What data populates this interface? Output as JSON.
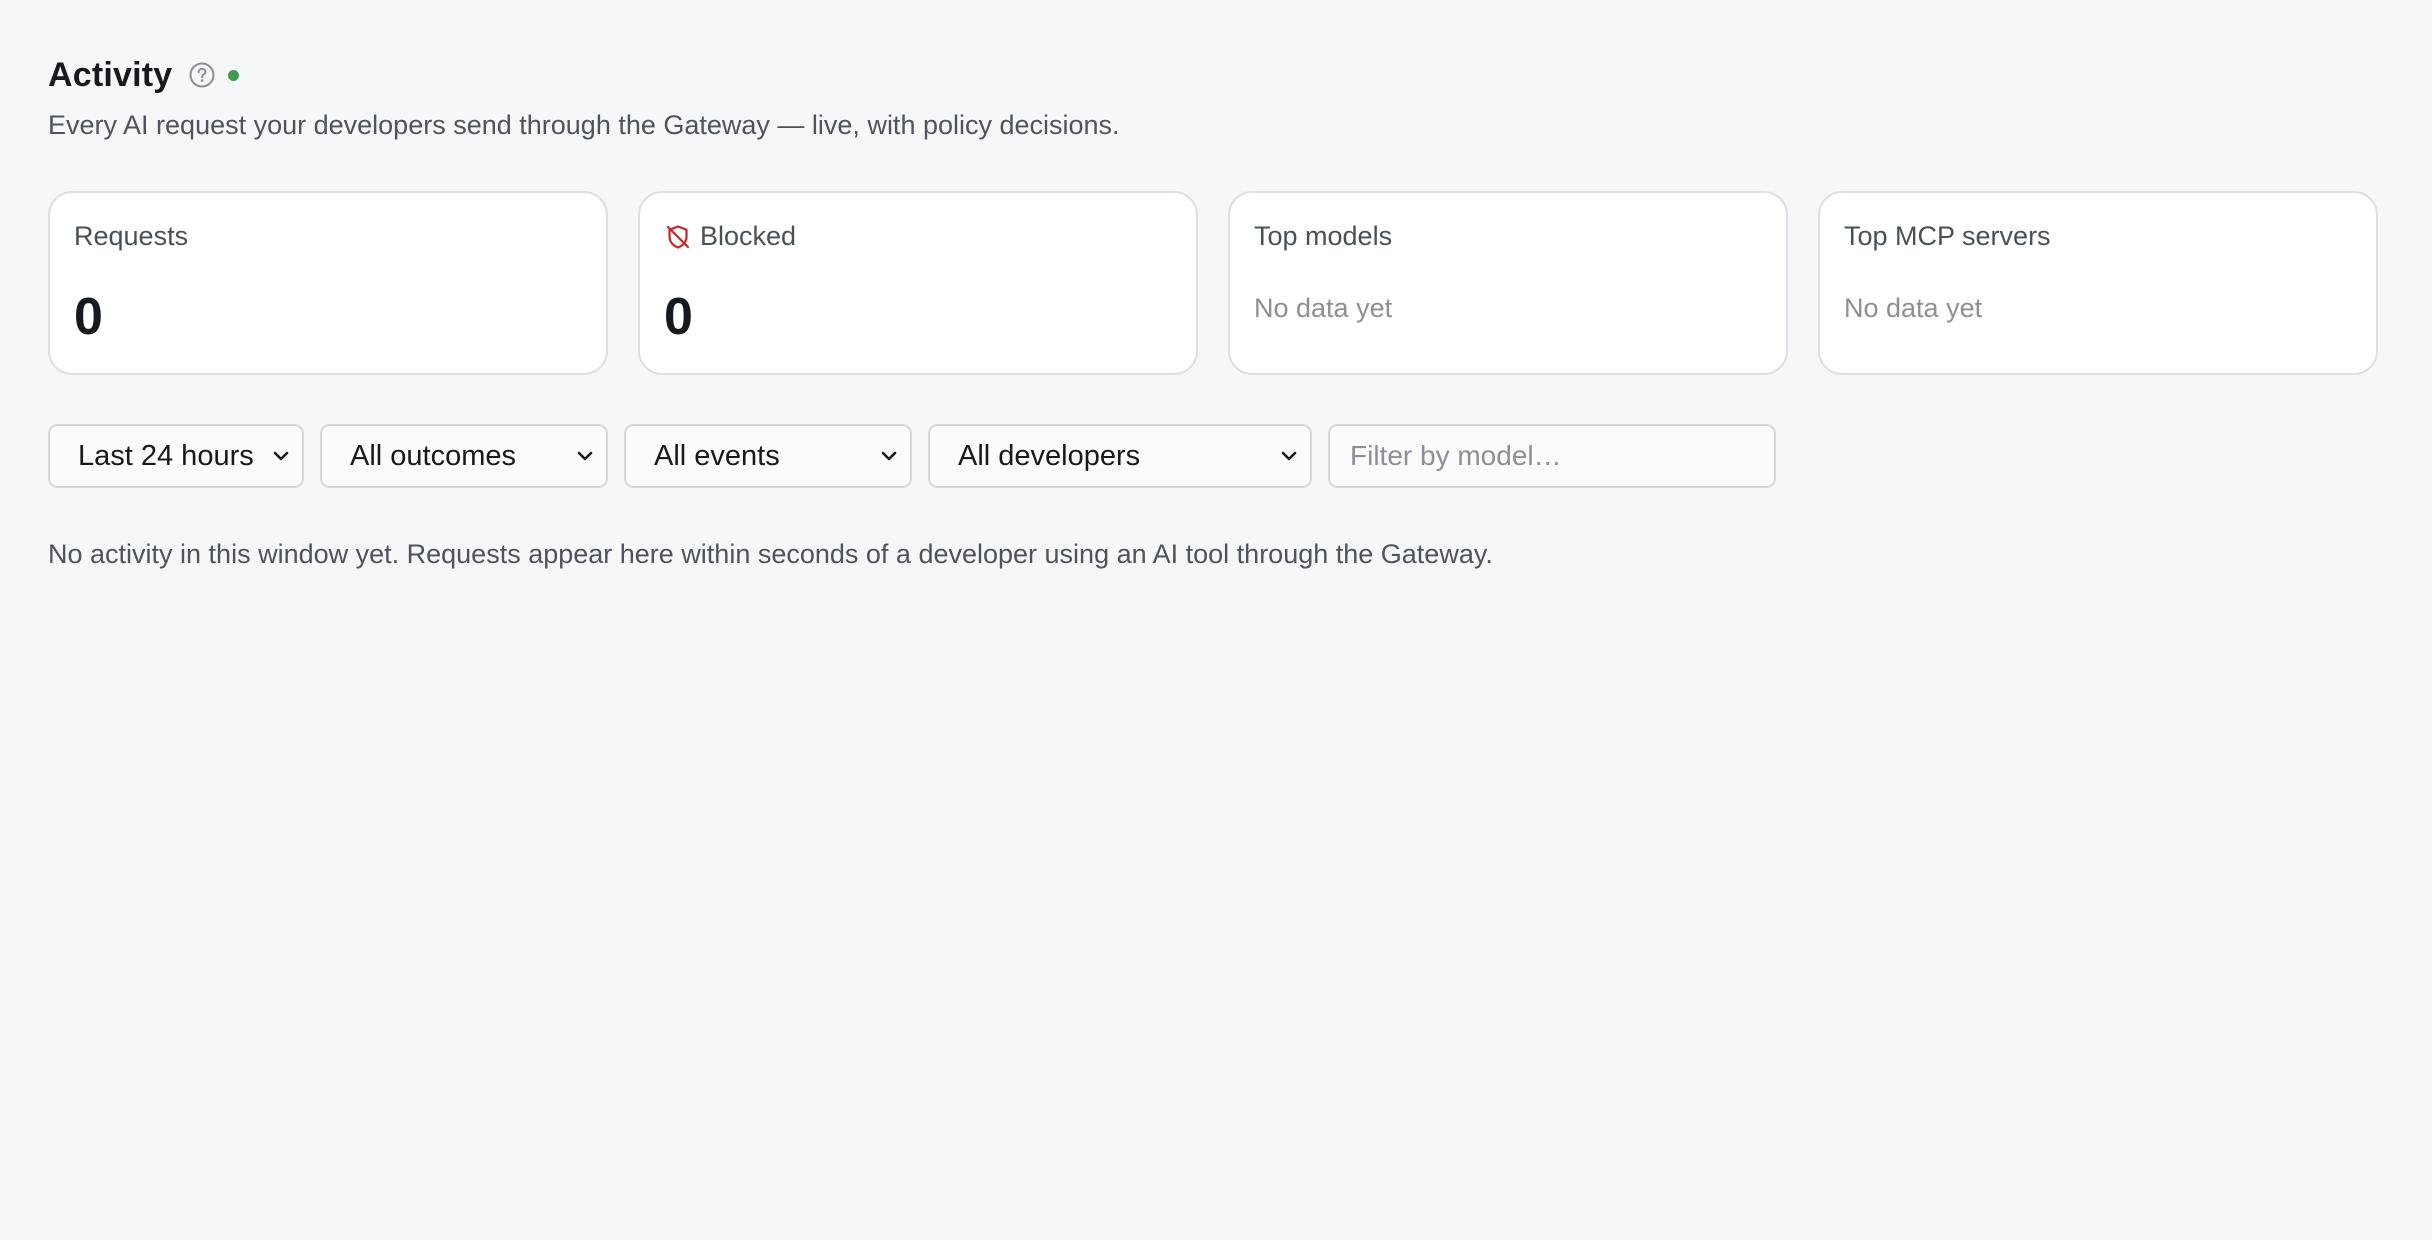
{
  "header": {
    "title": "Activity",
    "help_icon": "question-circle-icon",
    "live_status_color": "#3f9a4f",
    "subtitle": "Every AI request your developers send through the Gateway — live, with policy decisions."
  },
  "cards": {
    "requests": {
      "label": "Requests",
      "value": "0"
    },
    "blocked": {
      "label": "Blocked",
      "value": "0",
      "icon": "shield-off-icon",
      "icon_color": "#c62828"
    },
    "top_models": {
      "label": "Top models",
      "empty_text": "No data yet"
    },
    "top_mcp_servers": {
      "label": "Top MCP servers",
      "empty_text": "No data yet"
    }
  },
  "filters": {
    "time_range": {
      "selected": "Last 24 hours"
    },
    "outcome": {
      "selected": "All outcomes"
    },
    "event": {
      "selected": "All events"
    },
    "developer": {
      "selected": "All developers"
    },
    "model_search": {
      "placeholder": "Filter by model…",
      "value": ""
    }
  },
  "empty_state": {
    "message": "No activity in this window yet. Requests appear here within seconds of a developer using an AI tool through the Gateway."
  }
}
